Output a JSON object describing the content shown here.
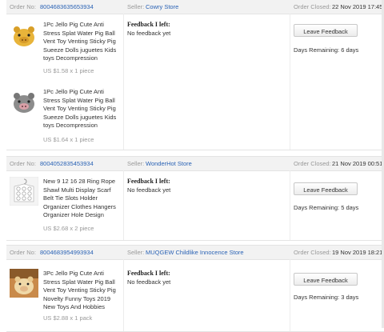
{
  "labels": {
    "order_no": "Order No:",
    "seller": "Seller:",
    "order_closed": "Order Closed:",
    "feedback_left": "Feedback I left:",
    "leave_feedback": "Leave Feedback"
  },
  "orders": [
    {
      "order_no": "8004683635653934",
      "seller": "Cowry Store",
      "closed": "22 Nov 2019 17:45",
      "feedback": "No feedback yet",
      "days_remaining": "Days Remaining: 6 days",
      "items": [
        {
          "title": "1Pc Jello Pig Cute Anti Stress Splat Water Pig Ball Vent Toy Venting Sticky Pig Sueeze Dolls juguetes Kids toys Decompression",
          "price": "US $1.58 x 1 piece",
          "image": "yellow-pig-toy"
        },
        {
          "title": "1Pc Jello Pig Cute Anti Stress Splat Water Pig Ball Vent Toy Venting Sticky Pig Sueeze Dolls juguetes Kids toys Decompression",
          "price": "US $1.64 x 1 piece",
          "image": "grey-pig-toy"
        }
      ]
    },
    {
      "order_no": "8004052835453934",
      "seller": "WonderHot Store",
      "closed": "21 Nov 2019 00:51",
      "feedback": "No feedback yet",
      "days_remaining": "Days Remaining: 5 days",
      "items": [
        {
          "title": "New 9 12 16 28 Ring Rope Shawl Multi Display Scarf Belt Tie Slots Holder Organizer Clothes Hangers Organizer Hole Design",
          "price": "US $2.68 x 2 piece",
          "image": "ring-hanger"
        }
      ]
    },
    {
      "order_no": "8004683954993934",
      "seller": "MUQGEW Childlike Innocence Store",
      "closed": "19 Nov 2019 18:21",
      "feedback": "No feedback yet",
      "days_remaining": "Days Remaining: 3 days",
      "items": [
        {
          "title": "3Pc Jello Pig Cute Anti Stress Splat Water Pig Ball Vent Toy Venting Sticky Pig Novelty Funny Toys 2019 New Toys And Hobbies",
          "price": "US $2.88 x 1 pack",
          "image": "pig-toys-pack"
        }
      ]
    }
  ],
  "colors": {
    "link": "#2b63b5",
    "muted": "#999999",
    "header_bg": "#f2f2f2"
  }
}
